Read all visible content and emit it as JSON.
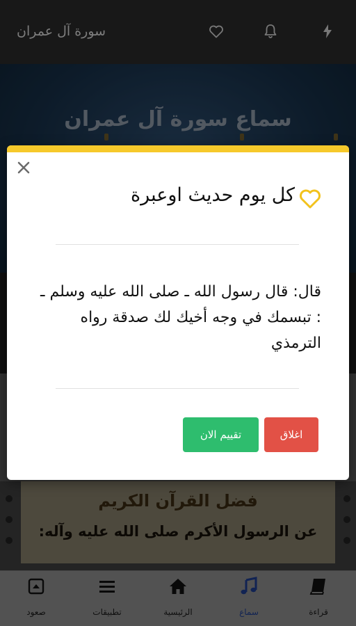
{
  "appbar": {
    "title": "سورة آل عمران",
    "icons": [
      "heart-outline-icon",
      "bell-icon",
      "bolt-icon"
    ]
  },
  "banner": {
    "title": "سماع سورة آل عمران"
  },
  "card": {
    "heading": "فضل القرآن الكريم",
    "line": "عن الرسول الأكرم صلى الله عليه وآله:"
  },
  "dialog": {
    "title": "كل يوم حديث اوعبرة",
    "body": "قال: قال رسول الله ـ صلى الله عليه وسلم ـ : تبسمك في وجه أخيك لك صدقة رواه الترمذي",
    "close_label": "اغلاق",
    "rate_label": "تقييم الان",
    "icons": [
      "close-icon",
      "heart-icon"
    ],
    "colors": {
      "accent_bar": "#f6c92b",
      "close": "#e25146",
      "rate": "#2ebd6e"
    }
  },
  "bottomnav": {
    "items": [
      {
        "label": "صعود",
        "icon": "scroll-up-icon"
      },
      {
        "label": "تطبيقات",
        "icon": "menu-icon"
      },
      {
        "label": "الرئيسية",
        "icon": "home-icon"
      },
      {
        "label": "سماع",
        "icon": "music-note-icon",
        "active": true
      },
      {
        "label": "قراءة",
        "icon": "book-icon"
      }
    ]
  }
}
